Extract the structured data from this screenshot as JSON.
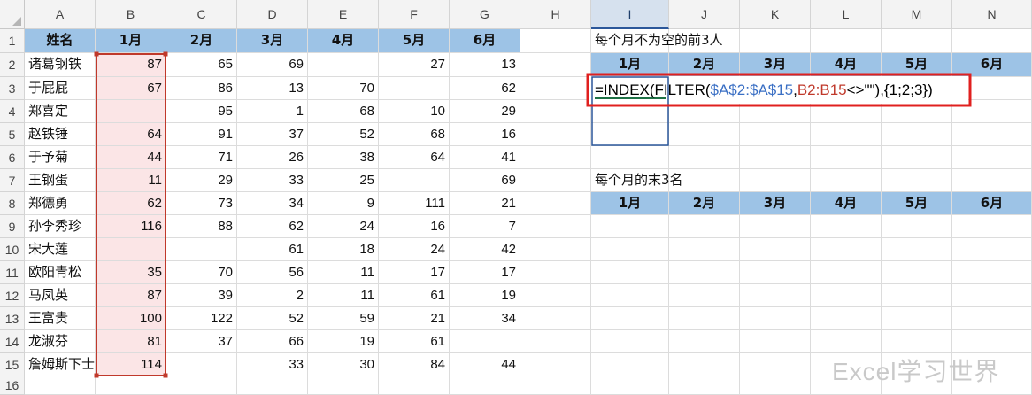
{
  "columns": [
    "A",
    "B",
    "C",
    "D",
    "E",
    "F",
    "G",
    "H",
    "I",
    "J",
    "K",
    "L",
    "M",
    "N"
  ],
  "rows": [
    "1",
    "2",
    "3",
    "4",
    "5",
    "6",
    "7",
    "8",
    "9",
    "10",
    "11",
    "12",
    "13",
    "14",
    "15",
    "16"
  ],
  "active_column": "I",
  "table": {
    "headers": [
      "姓名",
      "1月",
      "2月",
      "3月",
      "4月",
      "5月",
      "6月"
    ],
    "rows": [
      [
        "诸葛钢铁",
        "87",
        "65",
        "69",
        "",
        "27",
        "13"
      ],
      [
        "于屁屁",
        "67",
        "86",
        "13",
        "70",
        "",
        "62"
      ],
      [
        "郑喜定",
        "",
        "95",
        "1",
        "68",
        "10",
        "29"
      ],
      [
        "赵铁锤",
        "64",
        "91",
        "37",
        "52",
        "68",
        "16"
      ],
      [
        "于予菊",
        "44",
        "71",
        "26",
        "38",
        "64",
        "41"
      ],
      [
        "王钢蛋",
        "11",
        "29",
        "33",
        "25",
        "",
        "69"
      ],
      [
        "郑德勇",
        "62",
        "73",
        "34",
        "9",
        "111",
        "21"
      ],
      [
        "孙李秀珍",
        "116",
        "88",
        "62",
        "24",
        "16",
        "7"
      ],
      [
        "宋大莲",
        "",
        "",
        "61",
        "18",
        "24",
        "42"
      ],
      [
        "欧阳青松",
        "35",
        "70",
        "56",
        "11",
        "17",
        "17"
      ],
      [
        "马凤英",
        "87",
        "39",
        "2",
        "11",
        "61",
        "19"
      ],
      [
        "王富贵",
        "100",
        "122",
        "52",
        "59",
        "21",
        "34"
      ],
      [
        "龙淑芬",
        "81",
        "37",
        "66",
        "19",
        "61",
        ""
      ],
      [
        "詹姆斯下士",
        "114",
        "",
        "33",
        "30",
        "84",
        "44"
      ]
    ]
  },
  "top3": {
    "title": "每个月不为空的前3人",
    "headers": [
      "1月",
      "2月",
      "3月",
      "4月",
      "5月",
      "6月"
    ]
  },
  "last3": {
    "title": "每个月的末3名",
    "headers": [
      "1月",
      "2月",
      "3月",
      "4月",
      "5月",
      "6月"
    ]
  },
  "formula": {
    "parts": [
      {
        "text": "=INDEX(FILTER(",
        "color": "#000000"
      },
      {
        "text": "$A$2:$A$15",
        "color": "#3a6fc4"
      },
      {
        "text": ",",
        "color": "#000000"
      },
      {
        "text": "B2:B15",
        "color": "#c0392b"
      },
      {
        "text": "<>\"\"",
        "color": "#000000"
      },
      {
        "text": "),{1;2;3})",
        "color": "#000000"
      }
    ]
  },
  "watermark": "Excel学习世界",
  "colors": {
    "header_fill": "#9dc3e6",
    "highlight_fill": "#fbe5e6",
    "highlight_border": "#c0392b",
    "formula_box": "#e0201f",
    "selection": "#2b579a"
  }
}
